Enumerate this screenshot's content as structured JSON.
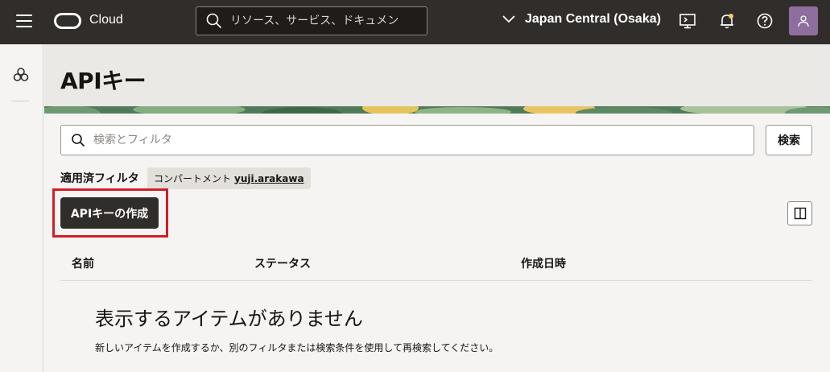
{
  "topbar": {
    "brand": "Cloud",
    "search_placeholder": "リソース、サービス、ドキュメン",
    "region": "Japan Central (Osaka)"
  },
  "page": {
    "title": "APIキー"
  },
  "filters": {
    "search_placeholder": "検索とフィルタ",
    "search_button": "検索",
    "applied_label": "適用済フィルタ",
    "chip_label": "コンパートメント",
    "chip_value": "yuji.arakawa"
  },
  "actions": {
    "create_button": "APIキーの作成"
  },
  "table": {
    "columns": [
      "名前",
      "ステータス",
      "作成日時"
    ]
  },
  "empty_state": {
    "title": "表示するアイテムがありません",
    "description": "新しいアイテムを作成するか、別のフィルタまたは検索条件を使用して再検索してください。"
  },
  "colors": {
    "topbar": "#312d2a",
    "highlight": "#d11f26",
    "avatar": "#8d6e9e"
  }
}
